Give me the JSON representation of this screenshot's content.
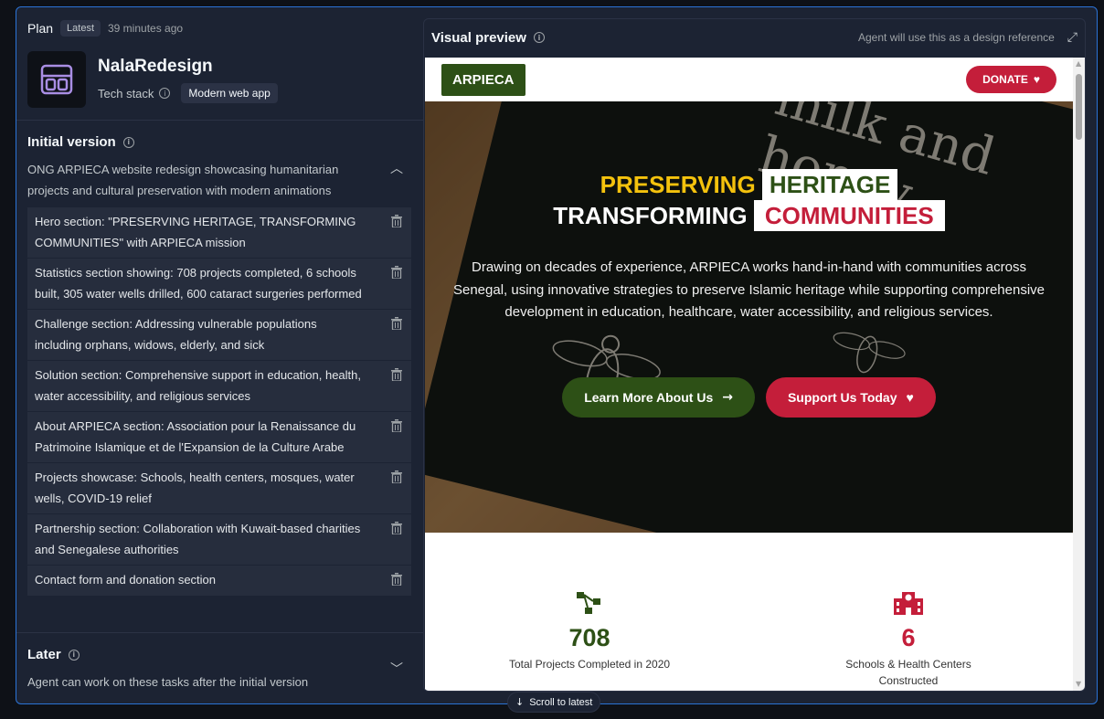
{
  "plan": {
    "label": "Plan",
    "badge": "Latest",
    "time": "39 minutes ago",
    "app_title": "NalaRedesign",
    "tech_stack_label": "Tech stack",
    "tech_stack_value": "Modern web app"
  },
  "initial": {
    "title": "Initial version",
    "desc": "ONG ARPIECA website redesign showcasing humanitarian projects and cultural preservation with modern animations",
    "tasks": [
      "Hero section: \"PRESERVING HERITAGE, TRANSFORMING COMMUNITIES\" with ARPIECA mission",
      "Statistics section showing: 708 projects completed, 6 schools built, 305 water wells drilled, 600 cataract surgeries performed",
      "Challenge section: Addressing vulnerable populations including orphans, widows, elderly, and sick",
      "Solution section: Comprehensive support in education, health, water accessibility, and religious services",
      "About ARPIECA section: Association pour la Renaissance du Patrimoine Islamique et de l'Expansion de la Culture Arabe",
      "Projects showcase: Schools, health centers, mosques, water wells, COVID-19 relief",
      "Partnership section: Collaboration with Kuwait-based charities and Senegalese authorities",
      "Contact form and donation section"
    ]
  },
  "later": {
    "title": "Later",
    "desc": "Agent can work on these tasks after the initial version"
  },
  "preview": {
    "title": "Visual preview",
    "meta": "Agent will use this as a design reference"
  },
  "site": {
    "logo": "ARPIECA",
    "donate": "DONATE",
    "hero_word1": "PRESERVING",
    "hero_word2": "HERITAGE",
    "hero_word3": "TRANSFORMING",
    "hero_word4": "COMMUNITIES",
    "hero_text": "Drawing on decades of experience, ARPIECA works hand-in-hand with communities across Senegal, using innovative strategies to preserve Islamic heritage while supporting comprehensive development in education, healthcare, water accessibility, and religious services.",
    "btn_learn": "Learn More About Us",
    "btn_support": "Support Us Today",
    "book_text": "milk and honey",
    "stats": [
      {
        "number": "708",
        "label": "Total Projects Completed in 2020",
        "color": "#2d5016"
      },
      {
        "number": "6",
        "label": "Schools & Health Centers Constructed",
        "color": "#c41e3a"
      }
    ]
  },
  "scroll_latest": "Scroll to latest",
  "colors": {
    "accent_green": "#2d5016",
    "accent_red": "#c41e3a",
    "accent_yellow": "#f4c20d",
    "panel_bg": "#1c2333",
    "frame_border": "#2b73d6"
  }
}
